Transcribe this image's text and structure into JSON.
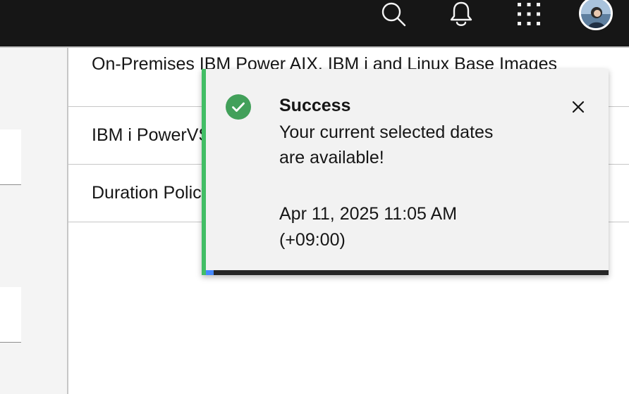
{
  "header": {
    "icons": [
      "search-icon",
      "notification-icon",
      "app-switcher-icon",
      "user-avatar"
    ],
    "background": "#161616"
  },
  "list": {
    "rows": [
      {
        "label": "On-Premises IBM Power AIX. IBM i and Linux Base Images"
      },
      {
        "label": "IBM i PowerVS"
      },
      {
        "label": "Duration Policy"
      }
    ]
  },
  "toast": {
    "kind": "success",
    "title": "Success",
    "subtitle": "Your current selected dates are available!",
    "caption": "Apr 11, 2025 11:05 AM (+09:00)",
    "accent_color": "#42be65",
    "progress": 0.02,
    "close_icon": "close-icon",
    "status_icon": "checkmark-filled-icon"
  }
}
